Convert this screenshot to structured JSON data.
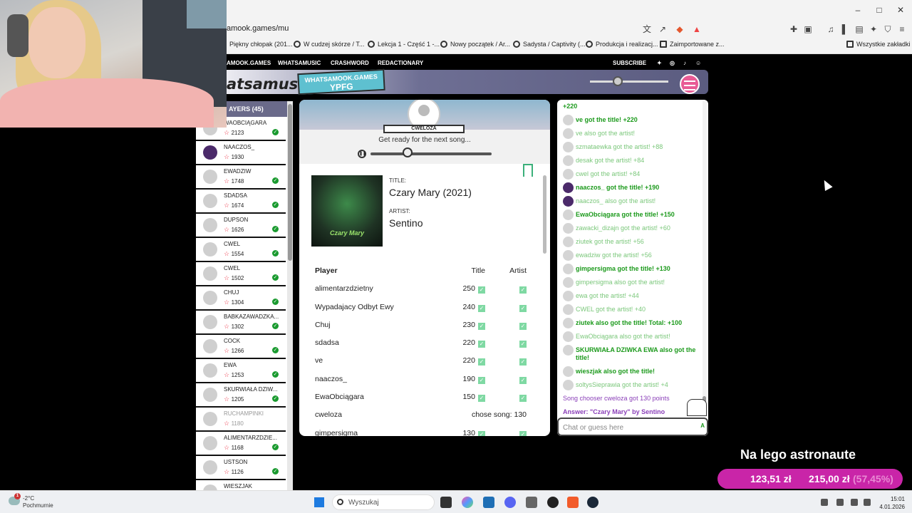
{
  "browser": {
    "url": "amook.games/mu",
    "bookmarks": [
      "Piękny chłopak (201...",
      "W cudzej skórze / T...",
      "Lekcja 1 - Część 1 -...",
      "Nowy początek / Ar...",
      "Sadysta / Captivity (...",
      "Produkcja i realizacj...",
      "Zaimportowane z...",
      "Wszystkie zakładki"
    ],
    "controls": {
      "minimize": "–",
      "maximize": "□",
      "close": "✕"
    }
  },
  "site": {
    "nav": [
      "AMOOK.GAMES",
      "WHATSAMUSIC",
      "CRASHWORD",
      "REDACTIONARY"
    ],
    "subscribe": "SUBSCRIBE",
    "logo": "atsamusic",
    "pill_top": "WHATSAMOOK.GAMES",
    "pill_bottom": "YPFG"
  },
  "players": {
    "header": "AYERS (45)",
    "list": [
      {
        "name": "WAOBCIĄGARA",
        "score": "2123",
        "ok": true,
        "self": false,
        "dim": false
      },
      {
        "name": "NAACZOS_",
        "score": "1930",
        "ok": false,
        "self": true,
        "dim": false
      },
      {
        "name": "EWADZIW",
        "score": "1748",
        "ok": true,
        "self": false,
        "dim": false
      },
      {
        "name": "SDADSA",
        "score": "1674",
        "ok": true,
        "self": false,
        "dim": false
      },
      {
        "name": "DUPSON",
        "score": "1626",
        "ok": true,
        "self": false,
        "dim": false
      },
      {
        "name": "CWEL",
        "score": "1554",
        "ok": true,
        "self": false,
        "dim": false
      },
      {
        "name": "CWEL",
        "score": "1502",
        "ok": true,
        "self": false,
        "dim": false
      },
      {
        "name": "CHUJ",
        "score": "1304",
        "ok": true,
        "self": false,
        "dim": false
      },
      {
        "name": "BABKAZAWADZKA...",
        "score": "1302",
        "ok": true,
        "self": false,
        "dim": false
      },
      {
        "name": "COCK",
        "score": "1266",
        "ok": true,
        "self": false,
        "dim": false
      },
      {
        "name": "EWA",
        "score": "1253",
        "ok": true,
        "self": false,
        "dim": false
      },
      {
        "name": "SKURWIAŁA DZIW...",
        "score": "1205",
        "ok": true,
        "self": false,
        "dim": false
      },
      {
        "name": "RUCHAMPINKI",
        "score": "1180",
        "ok": false,
        "self": false,
        "dim": true
      },
      {
        "name": "ALIMENTARZDZIE...",
        "score": "1168",
        "ok": true,
        "self": false,
        "dim": false
      },
      {
        "name": "USTSON",
        "score": "1126",
        "ok": true,
        "self": false,
        "dim": false
      },
      {
        "name": "WIESZJAK",
        "score": "",
        "ok": false,
        "self": false,
        "dim": false
      }
    ]
  },
  "round": {
    "host": "CWELOZA",
    "status": "Get ready for the next song...",
    "title_label": "TITLE:",
    "title": "Czary Mary (2021)",
    "artist_label": "ARTIST:",
    "artist": "Sentino",
    "cover_text": "Czary Mary",
    "columns": [
      "Player",
      "Title",
      "Artist"
    ],
    "results": [
      {
        "player": "alimentarzdzietny",
        "title": "250",
        "artist": true
      },
      {
        "player": "Wypadajacy Odbyt Ewy",
        "title": "240",
        "artist": true
      },
      {
        "player": "Chuj",
        "title": "230",
        "artist": true
      },
      {
        "player": "sdadsa",
        "title": "220",
        "artist": true
      },
      {
        "player": "ve",
        "title": "220",
        "artist": true
      },
      {
        "player": "naaczos_",
        "title": "190",
        "artist": true
      },
      {
        "player": "EwaObciągara",
        "title": "150",
        "artist": true
      },
      {
        "player": "cweloza",
        "title": "chose song: 130",
        "artist": false
      },
      {
        "player": "gimpersigma",
        "title": "130",
        "artist": true
      }
    ]
  },
  "chat": {
    "messages": [
      {
        "text": "+220",
        "kind": "top",
        "avatar": ""
      },
      {
        "text": "ve got the title! +220",
        "kind": "bold",
        "avatar": "gray"
      },
      {
        "text": "ve also got the artist!",
        "kind": "light",
        "avatar": "gray"
      },
      {
        "text": "szmataewka got the artist! +88",
        "kind": "light",
        "avatar": "gray"
      },
      {
        "text": "desak got the artist! +84",
        "kind": "light",
        "avatar": "gray"
      },
      {
        "text": "cwel got the artist! +84",
        "kind": "light",
        "avatar": "gray"
      },
      {
        "text": "naaczos_ got the title! +190",
        "kind": "bold",
        "avatar": "self"
      },
      {
        "text": "naaczos_ also got the artist!",
        "kind": "light",
        "avatar": "self"
      },
      {
        "text": "EwaObciągara got the title! +150",
        "kind": "bold",
        "avatar": "gray"
      },
      {
        "text": "zawacki_dizajn got the artist! +60",
        "kind": "light",
        "avatar": "gray"
      },
      {
        "text": "ziutek got the artist! +56",
        "kind": "light",
        "avatar": "gray"
      },
      {
        "text": "ewadziw got the artist! +56",
        "kind": "light",
        "avatar": "gray"
      },
      {
        "text": "gimpersigma got the title! +130",
        "kind": "bold",
        "avatar": "gray"
      },
      {
        "text": "gimpersigma also got the artist!",
        "kind": "light",
        "avatar": "gray"
      },
      {
        "text": "ewa got the artist! +44",
        "kind": "light",
        "avatar": "gray"
      },
      {
        "text": "CWEL got the artist! +40",
        "kind": "light",
        "avatar": "gray"
      },
      {
        "text": "ziutek also got the title! Total: +100",
        "kind": "bold",
        "avatar": "gray"
      },
      {
        "text": "EwaObciągara also got the artist!",
        "kind": "light",
        "avatar": "gray"
      },
      {
        "text": "SKURWIAŁA DZIWKA EWA also got the title!",
        "kind": "bold",
        "avatar": "gray"
      },
      {
        "text": "wieszjak also got the title!",
        "kind": "bold",
        "avatar": "gray"
      },
      {
        "text": "soltysSieprawia got the artist! +4",
        "kind": "light",
        "avatar": "gray"
      },
      {
        "text": "Song chooser cweloza got 130 points",
        "kind": "sys",
        "avatar": ""
      },
      {
        "text": "Answer: \"Czary Mary\" by Sentino",
        "kind": "sys b",
        "avatar": ""
      }
    ],
    "placeholder": "Chat or guess here",
    "send": "A"
  },
  "overlay": {
    "stream_title": "Na lego astronaute",
    "goal_current": "123,51 zł",
    "goal_target": "215,00 zł",
    "goal_percent": "(57,45%)"
  },
  "taskbar": {
    "weather_temp": "-2°C",
    "weather_desc": "Pochmurnie",
    "weather_badge": "1",
    "search": "Wyszukaj",
    "time": "15:01",
    "date": "4.01.2026"
  }
}
